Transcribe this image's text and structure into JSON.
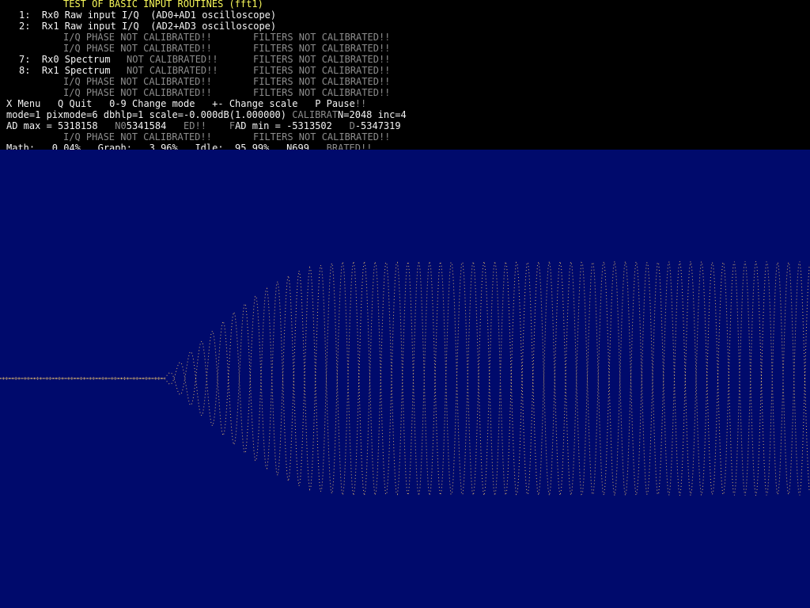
{
  "title": "TEST OF BASIC INPUT ROUTINES (fft1)",
  "menu_items": [
    {
      "key": "1:",
      "label": "Rx0 Raw input I/Q",
      "desc": "(AD0+AD1 oscilloscope)"
    },
    {
      "key": "2:",
      "label": "Rx1 Raw input I/Q",
      "desc": "(AD2+AD3 oscilloscope)"
    },
    {
      "key": "7:",
      "label": "Rx0 Spectrum"
    },
    {
      "key": "8:",
      "label": "Rx1 Spectrum"
    }
  ],
  "warnings": {
    "phase": "I/Q PHASE NOT CALIBRATED!!",
    "filters": "FILTERS NOT CALIBRATED!!",
    "not_calibrated": "NOT CALIBRATED!!"
  },
  "controls": {
    "menu": "X Menu",
    "quit": "Q Quit",
    "mode": "0-9 Change mode",
    "scale": "+- Change scale",
    "pause": "P Pause",
    "pause_tail": "!!"
  },
  "status": {
    "mode_line": "mode=1 pixmode=6 dbhlp=1 scale=-0.000dB(1.000000)",
    "calib_fragment": "CALIBRAT",
    "fft_info": "N=2048 inc=4",
    "ad_max": "AD max = 5318158",
    "ad_max_frag_prefix": "N",
    "ad_max_frag_value": "0",
    "ad_max2": "5341584",
    "frag_ed": "ED!!",
    "frag_f": "F",
    "ad_min": "AD min = -5313502",
    "frag_d": "D",
    "ad_min2": "-5347319",
    "math": "Math:   0.04%",
    "graph": "Graph:   3.96%",
    "idle": "Idle:  95.99%",
    "frag_n": "N699",
    "frag_brated": "BRATED!!"
  },
  "colors": {
    "title": "#f8f85a",
    "text": "#f4f4f4",
    "dim_text": "#8c8c8c",
    "scope_background": "#000a6c",
    "trace": "#ffd070"
  }
}
